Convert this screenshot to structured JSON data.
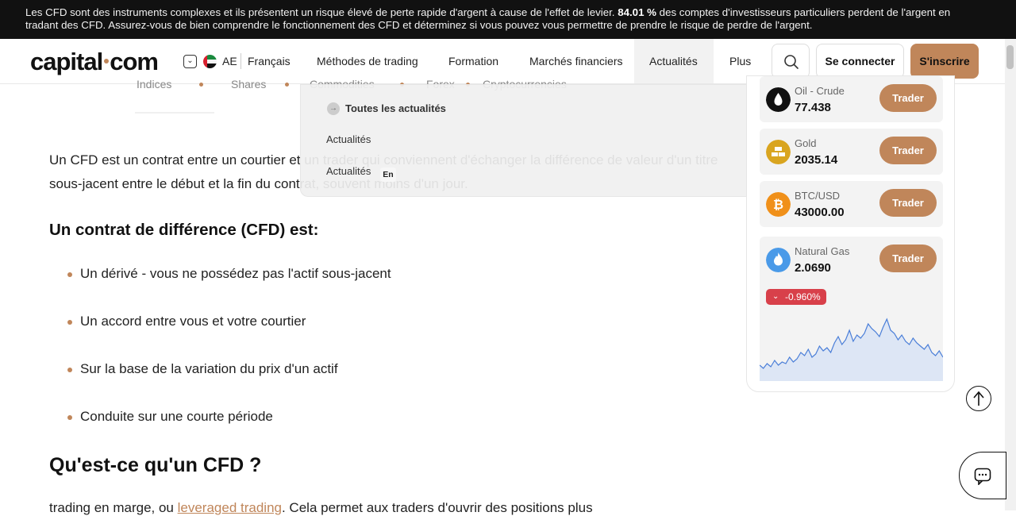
{
  "risk_banner": {
    "text_before": "Les CFD sont des instruments complexes et ils présentent un risque élevé de perte rapide d'argent à cause de l'effet de levier. ",
    "percent": "84.01 %",
    "text_after": " des comptes d'investisseurs particuliers perdent de l'argent en tradant des CFD. Assurez-vous de bien comprendre le fonctionnement des CFD et déterminez si vous pouvez vous permettre de prendre le risque de perdre de l'argent."
  },
  "header": {
    "logo_left": "capital",
    "logo_right": "com",
    "region": "AE",
    "language": "Français",
    "nav": [
      "Méthodes de trading",
      "Formation",
      "Marchés financiers",
      "Actualités",
      "Plus"
    ],
    "login": "Se connecter",
    "signup": "S'inscrire"
  },
  "market_tabs": [
    "Indices",
    "Shares",
    "Commodities",
    "Forex",
    "Cryptocurrencies"
  ],
  "dropdown": {
    "all_news": "Toutes les actualités",
    "item1": "Actualités",
    "item2": "Actualités",
    "item2_badge": "En"
  },
  "article": {
    "intro": "Un CFD est un contrat entre un courtier et un trader qui conviennent d'échanger la différence de valeur d'un titre sous-jacent entre le début et la fin du contrat, souvent moins d'un jour.",
    "heading1": "Un contrat de différence (CFD) est:",
    "bullets": [
      "Un dérivé - vous ne possédez pas l'actif sous-jacent",
      "Un accord entre vous et votre courtier",
      "Sur la base de la variation du prix d'un actif",
      "Conduite sur une courte période"
    ],
    "heading2": "Qu'est-ce qu'un CFD ?",
    "cut_before": "trading en marge, ou ",
    "cut_link": "leveraged trading",
    "cut_after": ". Cela permet aux traders d'ouvrir des positions plus"
  },
  "widget": {
    "trade_label": "Trader",
    "assets": [
      {
        "name": "Oil - Crude",
        "price": "77.438",
        "icon": "oil-drop-icon"
      },
      {
        "name": "Gold",
        "price": "2035.14",
        "icon": "gold-bars-icon"
      },
      {
        "name": "BTC/USD",
        "price": "43000.00",
        "icon": "bitcoin-icon"
      },
      {
        "name": "Natural Gas",
        "price": "2.0690",
        "icon": "flame-icon"
      }
    ],
    "change": "-0.960%",
    "spark_values": [
      4,
      2,
      5,
      3,
      7,
      4,
      6,
      5,
      9,
      6,
      8,
      12,
      10,
      14,
      9,
      11,
      16,
      13,
      15,
      12,
      18,
      22,
      17,
      20,
      26,
      19,
      23,
      21,
      24,
      30,
      27,
      25,
      22,
      28,
      33,
      26,
      24,
      20,
      23,
      19,
      17,
      21,
      18,
      16,
      14,
      17,
      12,
      10,
      13,
      9
    ]
  },
  "colors": {
    "accent": "#c0865a",
    "negative": "#d8404a",
    "spark_line": "#4a7ed8"
  }
}
